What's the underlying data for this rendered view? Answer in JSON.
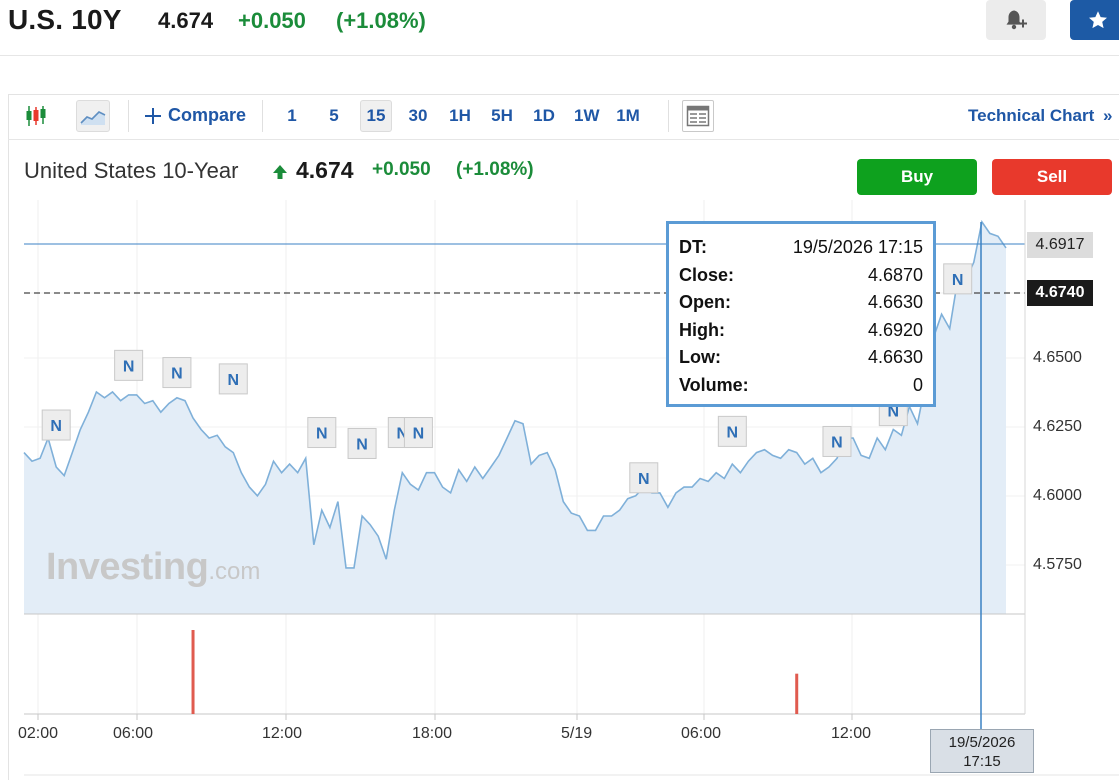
{
  "header": {
    "instrument": "U.S. 10Y",
    "price": "4.674",
    "change": "+0.050",
    "change_pct": "(+1.08%)"
  },
  "icons": {
    "alert": "bell-plus-icon",
    "watchlist": "star-icon",
    "candles": "candlestick-icon",
    "area": "area-chart-icon",
    "compare": "plus-icon",
    "layout": "layout-icon",
    "up": "arrow-up-icon"
  },
  "toolbar": {
    "compare_label": "Compare",
    "intervals": [
      "1",
      "5",
      "15",
      "30",
      "1H",
      "5H",
      "1D",
      "1W",
      "1M"
    ],
    "active_interval": "15",
    "technical_label": "Technical Chart",
    "technical_chevron": "»"
  },
  "chart_header": {
    "title": "United States 10-Year",
    "price": "4.674",
    "change": "+0.050",
    "change_pct": "(+1.08%)",
    "buy_label": "Buy",
    "sell_label": "Sell"
  },
  "tooltip": {
    "rows": [
      {
        "k": "DT:",
        "v": "19/5/2026 17:15"
      },
      {
        "k": "Close:",
        "v": "4.6870"
      },
      {
        "k": "Open:",
        "v": "4.6630"
      },
      {
        "k": "High:",
        "v": "4.6920"
      },
      {
        "k": "Low:",
        "v": "4.6630"
      },
      {
        "k": "Volume:",
        "v": "0"
      }
    ]
  },
  "watermark": {
    "brand": "Investing",
    "suffix": ".com"
  },
  "colors": {
    "accent": "#1f57a6",
    "up": "#1b8c3a",
    "buy": "#0ea11e",
    "sell": "#e8392c",
    "line": "#7fb0d9",
    "fill": "#e3edf7"
  },
  "chart_data": {
    "type": "area",
    "y_ticks": [
      "4.6500",
      "4.6250",
      "4.6000",
      "4.5750"
    ],
    "ylim": [
      4.556,
      4.6996
    ],
    "x_ticks": [
      "02:00",
      "06:00",
      "12:00",
      "18:00",
      "5/19",
      "06:00",
      "12:00"
    ],
    "crosshair": {
      "value_label": "4.6917",
      "time_label": [
        "19/5/2026",
        "17:15"
      ]
    },
    "last_price_label": "4.6740",
    "news_marker_label": "N",
    "series": [
      {
        "values": [
          4.612,
          4.609,
          4.61,
          4.617,
          4.607,
          4.604,
          4.612,
          4.62,
          4.626,
          4.633,
          4.631,
          4.633,
          4.63,
          4.632,
          4.632,
          4.629,
          4.63,
          4.626,
          4.629,
          4.631,
          4.63,
          4.624,
          4.62,
          4.617,
          4.618,
          4.614,
          4.612,
          4.605,
          4.6,
          4.597,
          4.601,
          4.609,
          4.605,
          4.608,
          4.605,
          4.61,
          4.58,
          4.592,
          4.586,
          4.595,
          4.572,
          4.572,
          4.59,
          4.587,
          4.583,
          4.575,
          4.592,
          4.605,
          4.601,
          4.599,
          4.605,
          4.605,
          4.6,
          4.598,
          4.606,
          4.602,
          4.607,
          4.603,
          4.607,
          4.611,
          4.617,
          4.623,
          4.622,
          4.608,
          4.611,
          4.612,
          4.606,
          4.595,
          4.591,
          4.59,
          4.585,
          4.585,
          4.59,
          4.59,
          4.592,
          4.596,
          4.597,
          4.6,
          4.598,
          4.598,
          4.593,
          4.598,
          4.6,
          4.6,
          4.603,
          4.602,
          4.605,
          4.603,
          4.608,
          4.605,
          4.609,
          4.612,
          4.613,
          4.611,
          4.61,
          4.613,
          4.612,
          4.608,
          4.61,
          4.605,
          4.607,
          4.61,
          4.617,
          4.617,
          4.611,
          4.61,
          4.617,
          4.613,
          4.62,
          4.618,
          4.628,
          4.622,
          4.636,
          4.652,
          4.66,
          4.655,
          4.672,
          4.672,
          4.678,
          4.692,
          4.688,
          4.687,
          4.683
        ]
      }
    ],
    "news_markers": [
      {
        "x": 4,
        "y": 4.6212
      },
      {
        "x": 13,
        "y": 4.6419
      },
      {
        "x": 19,
        "y": 4.6394
      },
      {
        "x": 26,
        "y": 4.6372
      },
      {
        "x": 37,
        "y": 4.6186
      },
      {
        "x": 42,
        "y": 4.6148
      },
      {
        "x": 47,
        "y": 4.6186
      },
      {
        "x": 49,
        "y": 4.6186
      },
      {
        "x": 77,
        "y": 4.6029
      },
      {
        "x": 88,
        "y": 4.619
      },
      {
        "x": 101,
        "y": 4.6155
      },
      {
        "x": 108,
        "y": 4.6262
      },
      {
        "x": 116,
        "y": 4.6719
      }
    ],
    "volume_bars": [
      {
        "x": 21,
        "v": 1.0
      },
      {
        "x": 96,
        "v": 0.48
      }
    ]
  }
}
